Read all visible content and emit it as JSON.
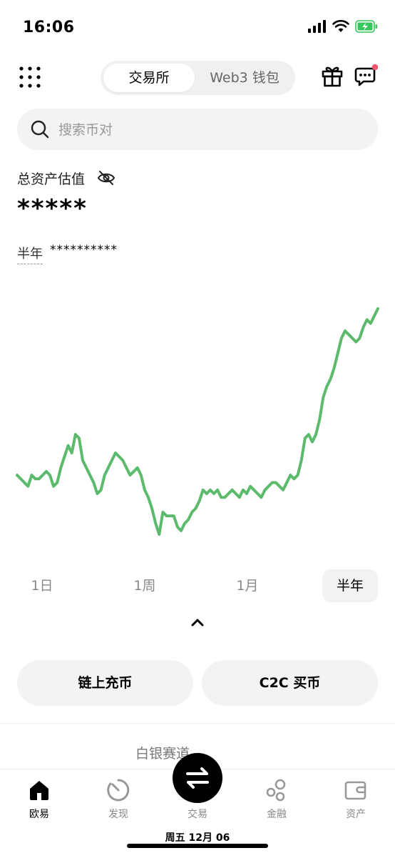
{
  "status_bar": {
    "time": "16:06",
    "icons": [
      "signal-icon",
      "wifi-icon",
      "battery-charging-icon"
    ],
    "battery_color": "#34c759"
  },
  "header": {
    "menu_icon": "grid-menu-icon",
    "segment": {
      "active": "交易所",
      "inactive": "Web3 钱包"
    },
    "gift_icon": "gift-icon",
    "message_icon": "message-icon",
    "notification_dot_color": "#f0536c"
  },
  "search": {
    "placeholder": "搜索币对"
  },
  "assets": {
    "label": "总资产估值",
    "value": "*****",
    "period_label": "半年",
    "period_value": "**********"
  },
  "chart_data": {
    "type": "line",
    "color": "#5cba6c",
    "y": [
      58,
      57,
      56,
      55,
      58,
      57,
      57,
      58,
      59,
      58,
      55,
      56,
      60,
      63,
      66,
      64,
      69,
      68,
      62,
      60,
      58,
      56,
      53,
      54,
      58,
      60,
      62,
      64,
      63,
      62,
      60,
      58,
      59,
      60,
      58,
      54,
      52,
      49,
      45,
      42,
      48,
      47,
      47,
      47,
      44,
      43,
      45,
      46,
      48,
      49,
      51,
      54,
      53,
      54,
      53,
      54,
      52,
      52,
      53,
      54,
      53,
      52,
      54,
      53,
      55,
      54,
      53,
      52,
      54,
      55,
      56,
      56,
      55,
      54,
      56,
      58,
      57,
      58,
      62,
      68,
      69,
      67,
      69,
      73,
      79,
      82,
      84,
      87,
      91,
      95,
      97,
      96,
      95,
      94,
      95,
      98,
      100,
      99,
      101,
      103
    ]
  },
  "range_tabs": [
    "1日",
    "1周",
    "1月",
    "半年"
  ],
  "range_selected": "半年",
  "actions": {
    "deposit": "链上充币",
    "c2c": "C2C 买币"
  },
  "promo": {
    "text": "白银赛道"
  },
  "bottom_nav": {
    "items": [
      {
        "label": "欧易",
        "icon": "home-icon"
      },
      {
        "label": "发现",
        "icon": "discover-icon"
      },
      {
        "label": "交易",
        "icon": "swap-icon"
      },
      {
        "label": "金融",
        "icon": "earn-icon"
      },
      {
        "label": "资产",
        "icon": "wallet-icon"
      }
    ],
    "active": "欧易"
  },
  "bottom_date": "周五 12月 06"
}
